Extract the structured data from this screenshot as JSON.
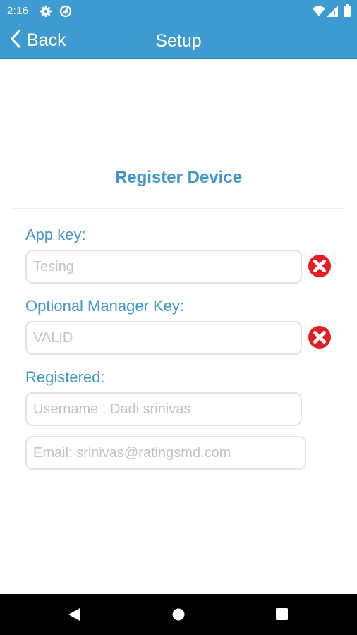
{
  "status_bar": {
    "time": "2:16",
    "icons": [
      "gear-icon",
      "sync-icon",
      "wifi-icon",
      "signal-icon",
      "battery-icon"
    ]
  },
  "app_bar": {
    "back_label": "Back",
    "title": "Setup",
    "color": "#3d9bd1"
  },
  "form": {
    "title": "Register Device",
    "app_key": {
      "label": "App key:",
      "value": "Tesing"
    },
    "manager_key": {
      "label": "Optional Manager Key:",
      "value": "VALID"
    },
    "registered": {
      "label": "Registered:",
      "username": "Username : Dadi srinivas",
      "email": "Email: srinivas@ratingsmd.com"
    },
    "accent_color": "#3f96cb",
    "error_color": "#e31e24"
  },
  "nav_bar": {
    "icons": [
      "back-triangle-icon",
      "home-circle-icon",
      "recents-square-icon"
    ]
  }
}
